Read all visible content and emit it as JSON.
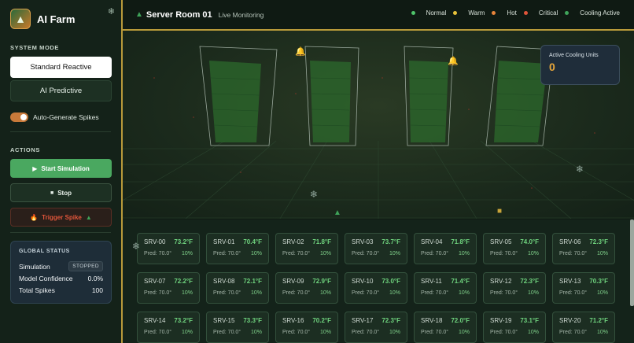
{
  "sidebar": {
    "brand_title": "AI Farm",
    "brand_icon": "server-tree-icon",
    "system_mode_label": "SYSTEM MODE",
    "modes": [
      {
        "label": "Standard Reactive",
        "active": true
      },
      {
        "label": "AI Predictive",
        "active": false
      }
    ],
    "auto_spikes_label": "Auto-Generate Spikes",
    "auto_spikes_on": true,
    "actions_label": "ACTIONS",
    "start_label": "Start Simulation",
    "stop_label": "Stop",
    "spike_label": "Trigger Spike",
    "status": {
      "title": "GLOBAL STATUS",
      "simulation_label": "Simulation",
      "simulation_value": "STOPPED",
      "confidence_label": "Model Confidence",
      "confidence_value": "0.0%",
      "spikes_label": "Total Spikes",
      "spikes_value": "100"
    }
  },
  "header": {
    "title": "Server Room 01",
    "subtitle": "Live Monitoring",
    "legend": [
      {
        "label": "Normal",
        "color": "#4fc46a"
      },
      {
        "label": "Warm",
        "color": "#e8c23a"
      },
      {
        "label": "Hot",
        "color": "#e8843a"
      },
      {
        "label": "Critical",
        "color": "#e0553a"
      },
      {
        "label": "Cooling Active",
        "color": "#3fa45a"
      }
    ]
  },
  "cooling": {
    "label": "Active Cooling Units",
    "value": "0"
  },
  "servers": [
    {
      "name": "SRV-00",
      "temp": "73.2°F",
      "pred": "Pred: 70.0°",
      "pct": "10%"
    },
    {
      "name": "SRV-01",
      "temp": "70.4°F",
      "pred": "Pred: 70.0°",
      "pct": "10%"
    },
    {
      "name": "SRV-02",
      "temp": "71.8°F",
      "pred": "Pred: 70.0°",
      "pct": "10%"
    },
    {
      "name": "SRV-03",
      "temp": "73.7°F",
      "pred": "Pred: 70.0°",
      "pct": "10%"
    },
    {
      "name": "SRV-04",
      "temp": "71.8°F",
      "pred": "Pred: 70.0°",
      "pct": "10%"
    },
    {
      "name": "SRV-05",
      "temp": "74.0°F",
      "pred": "Pred: 70.0°",
      "pct": "10%"
    },
    {
      "name": "SRV-06",
      "temp": "72.3°F",
      "pred": "Pred: 70.0°",
      "pct": "10%"
    },
    {
      "name": "SRV-07",
      "temp": "72.2°F",
      "pred": "Pred: 70.0°",
      "pct": "10%"
    },
    {
      "name": "SRV-08",
      "temp": "72.1°F",
      "pred": "Pred: 70.0°",
      "pct": "10%"
    },
    {
      "name": "SRV-09",
      "temp": "72.9°F",
      "pred": "Pred: 70.0°",
      "pct": "10%"
    },
    {
      "name": "SRV-10",
      "temp": "73.0°F",
      "pred": "Pred: 70.0°",
      "pct": "10%"
    },
    {
      "name": "SRV-11",
      "temp": "71.4°F",
      "pred": "Pred: 70.0°",
      "pct": "10%"
    },
    {
      "name": "SRV-12",
      "temp": "72.3°F",
      "pred": "Pred: 70.0°",
      "pct": "10%"
    },
    {
      "name": "SRV-13",
      "temp": "70.3°F",
      "pred": "Pred: 70.0°",
      "pct": "10%"
    },
    {
      "name": "SRV-14",
      "temp": "73.2°F",
      "pred": "Pred: 70.0°",
      "pct": "10%"
    },
    {
      "name": "SRV-15",
      "temp": "73.3°F",
      "pred": "Pred: 70.0°",
      "pct": "10%"
    },
    {
      "name": "SRV-16",
      "temp": "70.2°F",
      "pred": "Pred: 70.0°",
      "pct": "10%"
    },
    {
      "name": "SRV-17",
      "temp": "72.3°F",
      "pred": "Pred: 70.0°",
      "pct": "10%"
    },
    {
      "name": "SRV-18",
      "temp": "72.0°F",
      "pred": "Pred: 70.0°",
      "pct": "10%"
    },
    {
      "name": "SRV-19",
      "temp": "73.1°F",
      "pred": "Pred: 70.0°",
      "pct": "10%"
    },
    {
      "name": "SRV-20",
      "temp": "71.2°F",
      "pred": "Pred: 70.0°",
      "pct": "10%"
    }
  ]
}
